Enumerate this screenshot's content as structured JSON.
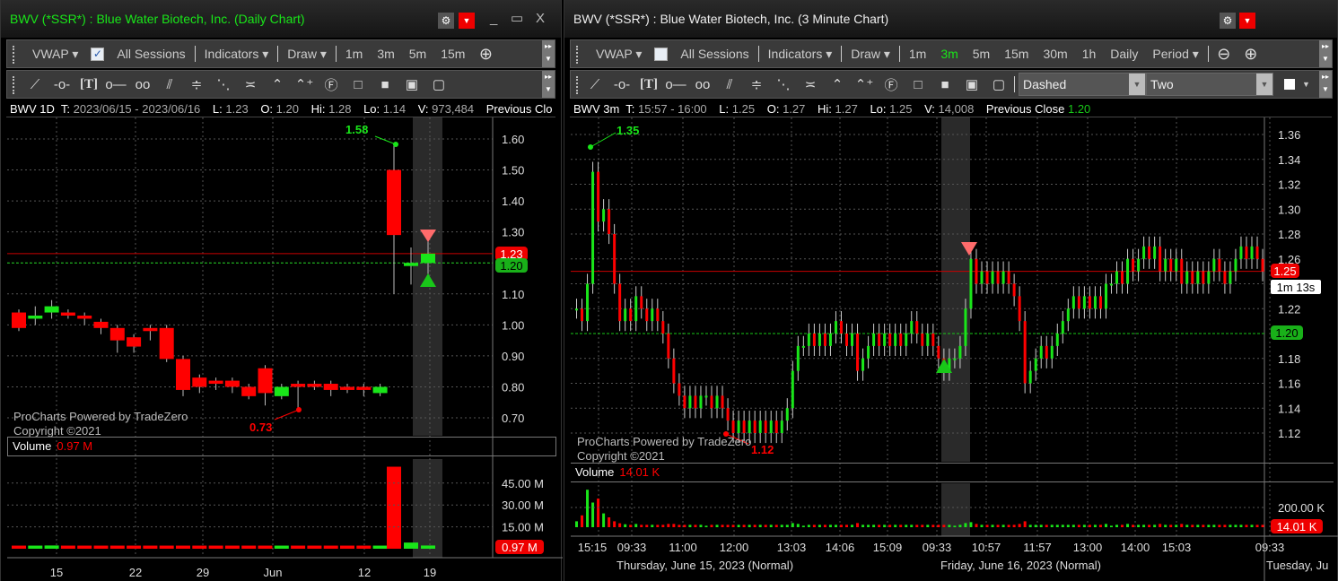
{
  "left": {
    "title": "BWV (*SSR*) : Blue Water Biotech, Inc. (Daily Chart)",
    "title_color": "#19e619",
    "window_controls": {
      "minimize": "_",
      "maximize": "▭",
      "close": "X"
    },
    "toolbar1": {
      "vwap": "VWAP ▾",
      "all_sessions": "All Sessions",
      "all_sessions_checked": true,
      "indicators": "Indicators ▾",
      "draw": "Draw ▾",
      "periods": [
        "1m",
        "3m",
        "5m",
        "15m"
      ]
    },
    "info": {
      "symbol": "BWV 1D",
      "t_label": "T:",
      "t": "2023/06/15 - 2023/06/16",
      "l_label": "L:",
      "l": "1.23",
      "o_label": "O:",
      "o": "1.20",
      "hi_label": "Hi:",
      "hi": "1.28",
      "lo_label": "Lo:",
      "lo": "1.14",
      "v_label": "V:",
      "v": "973,484",
      "prev_close": "Previous Clo"
    },
    "watermark": [
      "ProCharts Powered by TradeZero",
      "Copyright ©2021"
    ],
    "volume_label": "Volume",
    "volume_value": "0.97 M",
    "price_ticks": [
      "1.60",
      "1.50",
      "1.40",
      "1.30",
      "1.20",
      "1.10",
      "1.00",
      "0.90",
      "0.80",
      "0.70"
    ],
    "current_price_tag": "1.23",
    "prev_close_tag": "1.20",
    "high_marker": "1.58",
    "low_marker": "0.73",
    "volume_ticks": [
      "45.00 M",
      "30.00 M",
      "15.00 M"
    ],
    "volume_tag": "0.97 M",
    "date_ticks": [
      "15",
      "22",
      "29",
      "Jun",
      "12",
      "19"
    ]
  },
  "right": {
    "title": "BWV (*SSR*) : Blue Water Biotech, Inc. (3 Minute Chart)",
    "toolbar1": {
      "vwap": "VWAP ▾",
      "all_sessions": "All Sessions",
      "all_sessions_checked": false,
      "indicators": "Indicators ▾",
      "draw": "Draw ▾",
      "periods": [
        "1m",
        "3m",
        "5m",
        "15m",
        "30m",
        "1h",
        "Daily"
      ],
      "active_period": "3m",
      "period": "Period ▾"
    },
    "toolbar2": {
      "line_style": "Dashed",
      "line_width": "Two"
    },
    "info": {
      "symbol": "BWV 3m",
      "t_label": "T:",
      "t": "15:57 - 16:00",
      "l_label": "L:",
      "l": "1.25",
      "o_label": "O:",
      "o": "1.27",
      "hi_label": "Hi:",
      "hi": "1.27",
      "lo_label": "Lo:",
      "lo": "1.25",
      "v_label": "V:",
      "v": "14,008",
      "prev_close_label": "Previous Close",
      "prev_close": "1.20"
    },
    "watermark": [
      "ProCharts Powered by TradeZero",
      "Copyright ©2021"
    ],
    "volume_label": "Volume",
    "volume_value": "14.01 K",
    "price_ticks": [
      "1.36",
      "1.34",
      "1.32",
      "1.30",
      "1.28",
      "1.26",
      "1.24",
      "1.22",
      "1.20",
      "1.18",
      "1.16",
      "1.14",
      "1.12"
    ],
    "current_price_tag": "1.25",
    "countdown": "1m 13s",
    "prev_close_tag": "1.20",
    "high_marker": "1.35",
    "low_marker": "1.12",
    "volume_ticks": [
      "200.00 K"
    ],
    "volume_tag": "14.01 K",
    "time_ticks": [
      "15:15",
      "09:33",
      "11:00",
      "12:00",
      "13:03",
      "14:06",
      "15:09",
      "09:33",
      "10:57",
      "11:57",
      "13:00",
      "14:00",
      "15:03",
      "09:33"
    ],
    "date_labels": [
      "Thursday, June 15, 2023 (Normal)",
      "Friday, June 16, 2023 (Normal)",
      "Tuesday, Ju"
    ]
  },
  "chart_data": [
    {
      "type": "candlestick",
      "title": "BWV Daily",
      "ylim": [
        0.7,
        1.6
      ],
      "ohlc": [
        [
          1.04,
          1.05,
          0.98,
          0.99
        ],
        [
          1.02,
          1.06,
          1.0,
          1.03
        ],
        [
          1.04,
          1.08,
          1.02,
          1.06
        ],
        [
          1.04,
          1.05,
          1.02,
          1.03
        ],
        [
          1.03,
          1.04,
          1.0,
          1.02
        ],
        [
          1.01,
          1.02,
          0.97,
          0.99
        ],
        [
          0.99,
          1.0,
          0.91,
          0.95
        ],
        [
          0.96,
          0.97,
          0.91,
          0.93
        ],
        [
          0.99,
          1.0,
          0.95,
          0.98
        ],
        [
          0.99,
          1.0,
          0.88,
          0.89
        ],
        [
          0.89,
          0.9,
          0.77,
          0.79
        ],
        [
          0.83,
          0.84,
          0.78,
          0.8
        ],
        [
          0.82,
          0.83,
          0.79,
          0.81
        ],
        [
          0.82,
          0.83,
          0.78,
          0.8
        ],
        [
          0.8,
          0.81,
          0.76,
          0.77
        ],
        [
          0.86,
          0.87,
          0.74,
          0.78
        ],
        [
          0.77,
          0.81,
          0.76,
          0.8
        ],
        [
          0.81,
          0.82,
          0.73,
          0.8
        ],
        [
          0.81,
          0.82,
          0.79,
          0.8
        ],
        [
          0.81,
          0.82,
          0.77,
          0.79
        ],
        [
          0.8,
          0.81,
          0.78,
          0.79
        ],
        [
          0.8,
          0.81,
          0.77,
          0.79
        ],
        [
          0.78,
          0.81,
          0.77,
          0.8
        ],
        [
          1.5,
          1.58,
          1.1,
          1.29
        ],
        [
          1.19,
          1.25,
          1.13,
          1.2
        ],
        [
          1.2,
          1.28,
          1.14,
          1.23
        ]
      ],
      "volume_m": [
        0.9,
        0.8,
        1.0,
        0.8,
        0.8,
        0.9,
        0.8,
        0.8,
        0.8,
        0.9,
        0.8,
        0.8,
        0.8,
        0.8,
        0.8,
        0.8,
        0.8,
        0.8,
        0.8,
        0.8,
        0.8,
        0.8,
        0.8,
        55,
        3,
        0.97
      ]
    },
    {
      "type": "candlestick",
      "title": "BWV 3 Minute",
      "ylim": [
        1.11,
        1.37
      ],
      "close": [
        1.22,
        1.21,
        1.24,
        1.33,
        1.29,
        1.3,
        1.28,
        1.24,
        1.21,
        1.22,
        1.21,
        1.23,
        1.22,
        1.21,
        1.22,
        1.21,
        1.2,
        1.18,
        1.16,
        1.15,
        1.14,
        1.15,
        1.14,
        1.15,
        1.15,
        1.14,
        1.15,
        1.14,
        1.13,
        1.12,
        1.13,
        1.12,
        1.13,
        1.12,
        1.13,
        1.12,
        1.13,
        1.12,
        1.13,
        1.14,
        1.17,
        1.19,
        1.19,
        1.2,
        1.19,
        1.2,
        1.19,
        1.2,
        1.21,
        1.2,
        1.19,
        1.2,
        1.17,
        1.18,
        1.19,
        1.2,
        1.19,
        1.2,
        1.19,
        1.2,
        1.19,
        1.2,
        1.21,
        1.2,
        1.19,
        1.2,
        1.19,
        1.18,
        1.17,
        1.18,
        1.18,
        1.19,
        1.22,
        1.26,
        1.24,
        1.25,
        1.24,
        1.25,
        1.24,
        1.25,
        1.24,
        1.23,
        1.21,
        1.16,
        1.17,
        1.18,
        1.19,
        1.18,
        1.19,
        1.2,
        1.21,
        1.22,
        1.23,
        1.22,
        1.23,
        1.22,
        1.23,
        1.22,
        1.24,
        1.24,
        1.25,
        1.24,
        1.26,
        1.25,
        1.26,
        1.27,
        1.26,
        1.27,
        1.25,
        1.26,
        1.25,
        1.26,
        1.24,
        1.25,
        1.24,
        1.25,
        1.24,
        1.25,
        1.26,
        1.25,
        1.24,
        1.25,
        1.26,
        1.27,
        1.26,
        1.27,
        1.26,
        1.25
      ],
      "volume_k_first": [
        60,
        120,
        380,
        250,
        290,
        140,
        100,
        60,
        40,
        30
      ],
      "volume_k_baseline": 15
    }
  ],
  "colors": {
    "up": "#19e619",
    "down": "#ff0000",
    "grid": "#555555",
    "prev_close": "#19c819",
    "current": "#c80000"
  }
}
